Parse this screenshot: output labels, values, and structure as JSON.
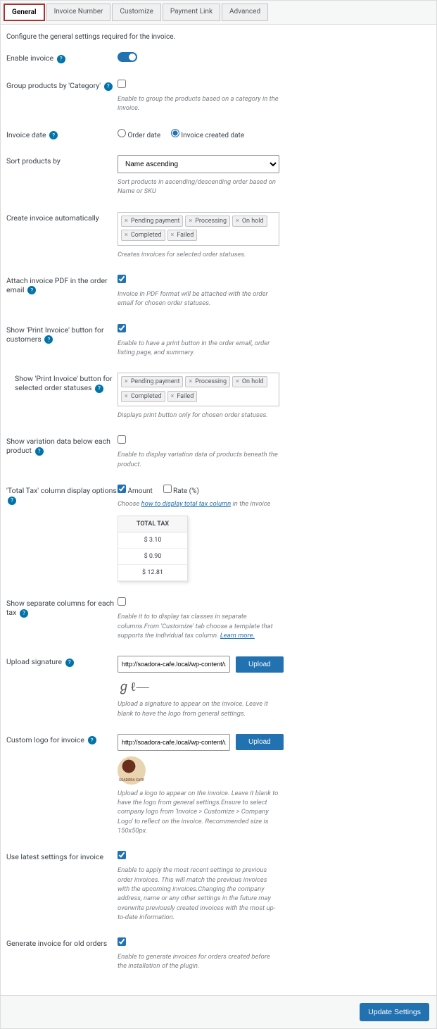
{
  "tabs": [
    "General",
    "Invoice Number",
    "Customize",
    "Payment Link",
    "Advanced"
  ],
  "intro": "Configure the general settings required for the invoice.",
  "fields": {
    "enable_invoice": "Enable invoice",
    "group_products": "Group products by 'Category'",
    "group_products_desc": "Enable to group the products based on a category in the invoice.",
    "invoice_date": "Invoice date",
    "invoice_date_opts": [
      "Order date",
      "Invoice created date"
    ],
    "sort_by": "Sort products by",
    "sort_by_value": "Name ascending",
    "sort_by_desc": "Sort products in ascending/descending order based on Name or SKU",
    "auto": "Create invoice automatically",
    "auto_tags": [
      "Pending payment",
      "Processing",
      "On hold",
      "Completed",
      "Failed"
    ],
    "auto_desc": "Creates invoices for selected order statuses.",
    "attach_pdf": "Attach invoice PDF in the order email",
    "attach_pdf_desc": "Invoice in PDF format will be attached with the order email for chosen order statuses.",
    "show_print": "Show 'Print Invoice' button for customers",
    "show_print_desc": "Enable to have a print button in the order email, order listing page, and summary.",
    "print_statuses": "Show 'Print Invoice' button for selected order statuses",
    "print_tags": [
      "Pending payment",
      "Processing",
      "On hold",
      "Completed",
      "Failed"
    ],
    "print_desc": "Displays print button only for chosen order statuses.",
    "variation": "Show variation data below each product",
    "variation_desc": "Enable to display variation data of products beneath the product.",
    "tax_col": "'Total Tax' column display options",
    "tax_opts": [
      "Amount",
      "Rate (%)"
    ],
    "tax_desc_pre": "Choose ",
    "tax_desc_link": "how to display total tax column",
    "tax_desc_post": " in the invoice",
    "tax_header": "TOTAL TAX",
    "tax_values": [
      "$ 3.10",
      "$ 0.90",
      "$ 12.81"
    ],
    "sep_cols": "Show separate columns for each tax",
    "sep_cols_desc_pre": "Enable it to to display tax classes in separate columns.From 'Customize' tab choose a template that supports the individual tax column. ",
    "sep_cols_link": "Learn more.",
    "sig": "Upload signature",
    "sig_val": "http://soadora-cafe.local/wp-content/up",
    "upload_btn": "Upload",
    "sig_desc": "Upload a signature to appear on the invoice. Leave it blank to have the logo from general settings.",
    "logo": "Custom logo for invoice",
    "logo_val": "http://soadora-cafe.local/wp-content/up",
    "logo_text": "SOADORA CAFE",
    "logo_desc": "Upload a logo to appear on the invoice. Leave it blank to have the logo from general settings.Ensure to select company logo from 'Invoice > Customize > Company Logo' to reflect on the invoice. Recommended size is 150x50px.",
    "latest": "Use latest settings for invoice",
    "latest_desc": "Enable to apply the most recent settings to previous order invoices. This will match the previous invoices with the upcoming invoices.Changing the company address, name or any other settings in the future may overwrite previously created invoices with the most up-to-date information.",
    "gen_old": "Generate invoice for old orders",
    "gen_old_desc": "Enable to generate invoices for orders created before the installation of the plugin."
  },
  "footer": {
    "save": "Update Settings"
  }
}
